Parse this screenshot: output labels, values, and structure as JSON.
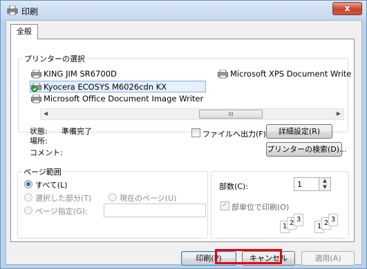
{
  "window": {
    "title": "印刷",
    "close_label": "x"
  },
  "tabs": [
    {
      "label": "全般"
    }
  ],
  "printer_select": {
    "group_label": "プリンターの選択",
    "printers": [
      {
        "name": "KING JIM SR6700D"
      },
      {
        "name": "Microsoft XPS Document Write"
      },
      {
        "name": "Kyocera ECOSYS M6026cdn KX",
        "selected": true
      },
      {
        "name": "Microsoft Office Document Image Writer"
      }
    ],
    "scroll_thumb_mark": "III",
    "status_label": "状態:",
    "status_value": "準備完了",
    "location_label": "場所:",
    "comment_label": "コメント:",
    "print_to_file_label": "ファイルへ出力(F)",
    "advanced_button": "詳細設定(R)",
    "find_printer_button": "プリンターの検索(D)..."
  },
  "page_range": {
    "group_label": "ページ範囲",
    "all_label": "すべて(L)",
    "selection_label": "選択した部分(T)",
    "current_page_label": "現在のページ(U)",
    "pages_label": "ページ指定(G):",
    "pages_value": "",
    "selected": "all"
  },
  "copies": {
    "copies_label": "部数(C):",
    "copies_value": "1",
    "collate_label": "部単位で印刷(O)",
    "collate_checked": true,
    "collate_pages": [
      "1",
      "2",
      "3"
    ]
  },
  "buttons": {
    "print": "印刷(P)",
    "cancel": "キャンセル",
    "apply": "適用(A)"
  },
  "colors": {
    "highlight": "#e60012",
    "title_bg": "#c4d8ee",
    "selected_bg": "#e5f0fb"
  }
}
